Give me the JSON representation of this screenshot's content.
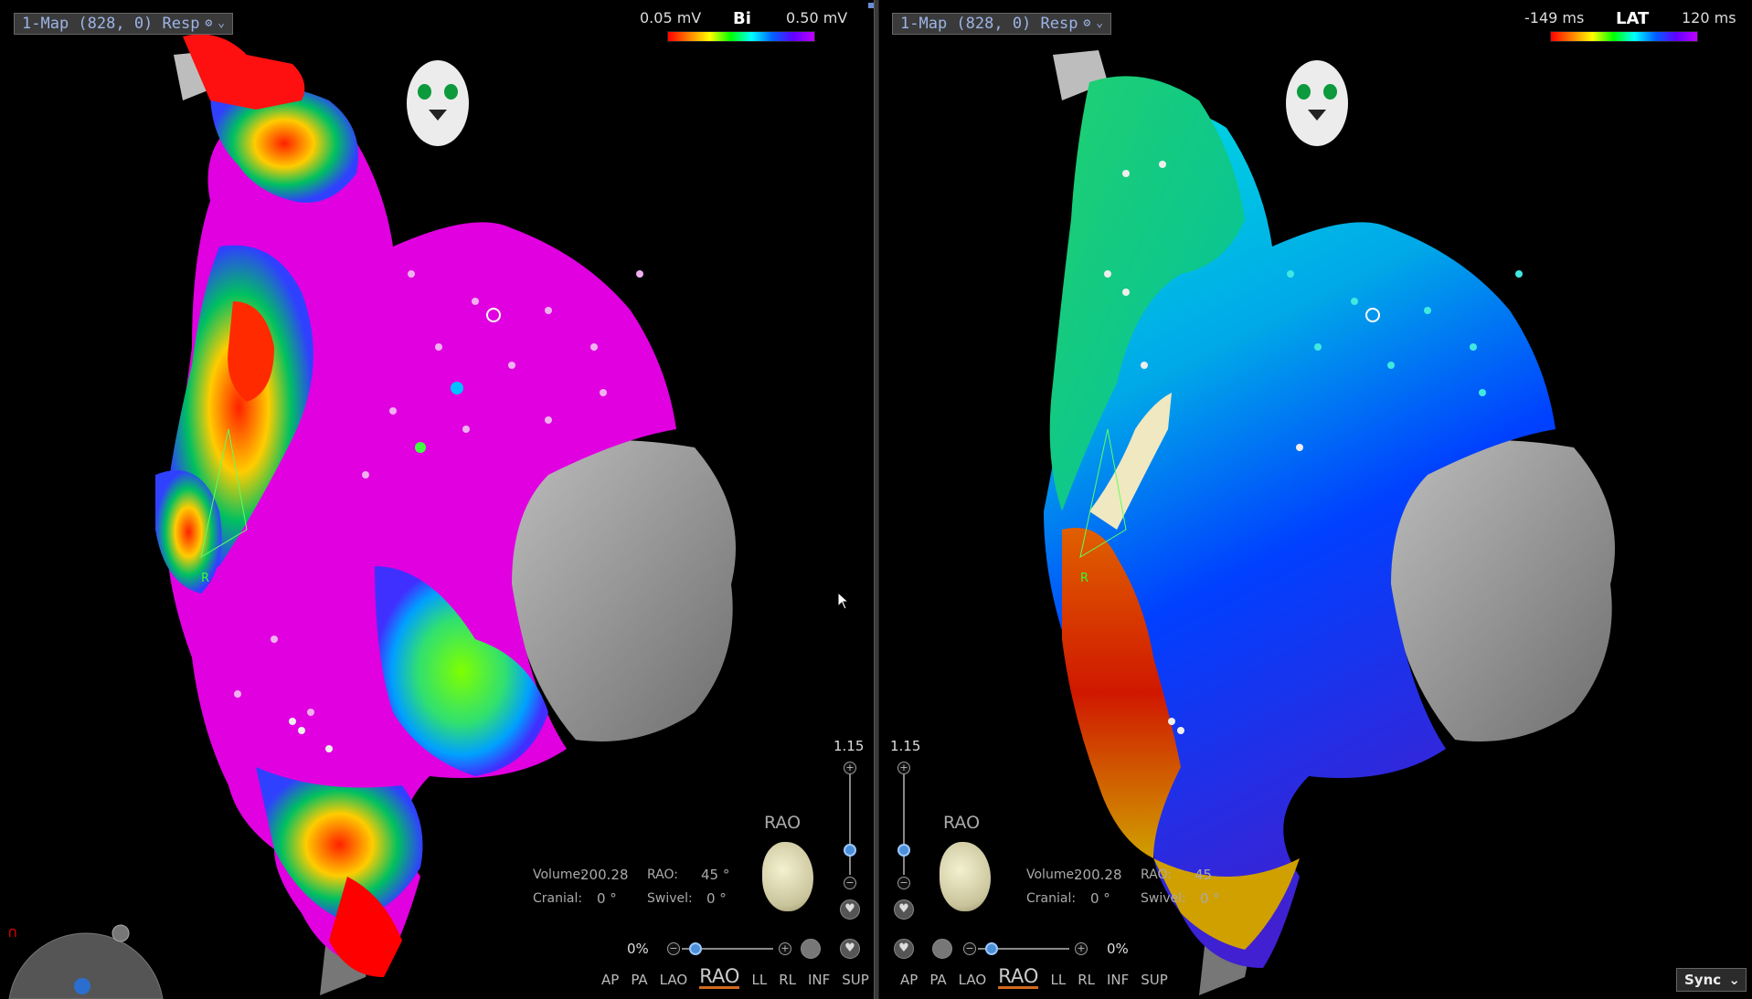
{
  "left_panel": {
    "map_selector": "1-Map (828, 0) Resp",
    "legend": {
      "low": "0.05 mV",
      "name": "Bi",
      "high": "0.50 mV"
    },
    "zoom": "1.15",
    "view_label": "RAO",
    "volume_label": "Volume:",
    "volume_value": "200.28",
    "rao_label": "RAO:",
    "rao_value": "45 °",
    "cranial_label": "Cranial:",
    "cranial_value": "0 °",
    "swivel_label": "Swivel:",
    "swivel_value": "0 °",
    "opacity": "0%",
    "tag_label": "R"
  },
  "right_panel": {
    "map_selector": "1-Map (828, 0) Resp",
    "legend": {
      "low": "-149 ms",
      "name": "LAT",
      "high": "120 ms"
    },
    "zoom": "1.15",
    "view_label": "RAO",
    "volume_label": "Volume:",
    "volume_value": "200.28",
    "rao_label": "RAO:",
    "rao_value": "45",
    "cranial_label": "Cranial:",
    "cranial_value": "0 °",
    "swivel_label": "Swivel:",
    "swivel_value": "0 °",
    "opacity": "0%",
    "tag_label": "R"
  },
  "view_buttons": [
    "AP",
    "PA",
    "LAO",
    "RAO",
    "LL",
    "RL",
    "INF",
    "SUP"
  ],
  "active_view": "RAO",
  "sync_button": "Sync",
  "icons": [
    "tools-icon",
    "chevron-down-icon",
    "face-orientation-icon",
    "mini-heart-icon",
    "zoom-in-icon",
    "zoom-out-icon",
    "heart-button-icon",
    "magnet-icon",
    "navigation-wheel-icon",
    "cursor-arrow-icon"
  ],
  "colors": {
    "map_selector_text": "#9db4e6",
    "active_view_underline": "#d2691e",
    "background": "#000000"
  }
}
